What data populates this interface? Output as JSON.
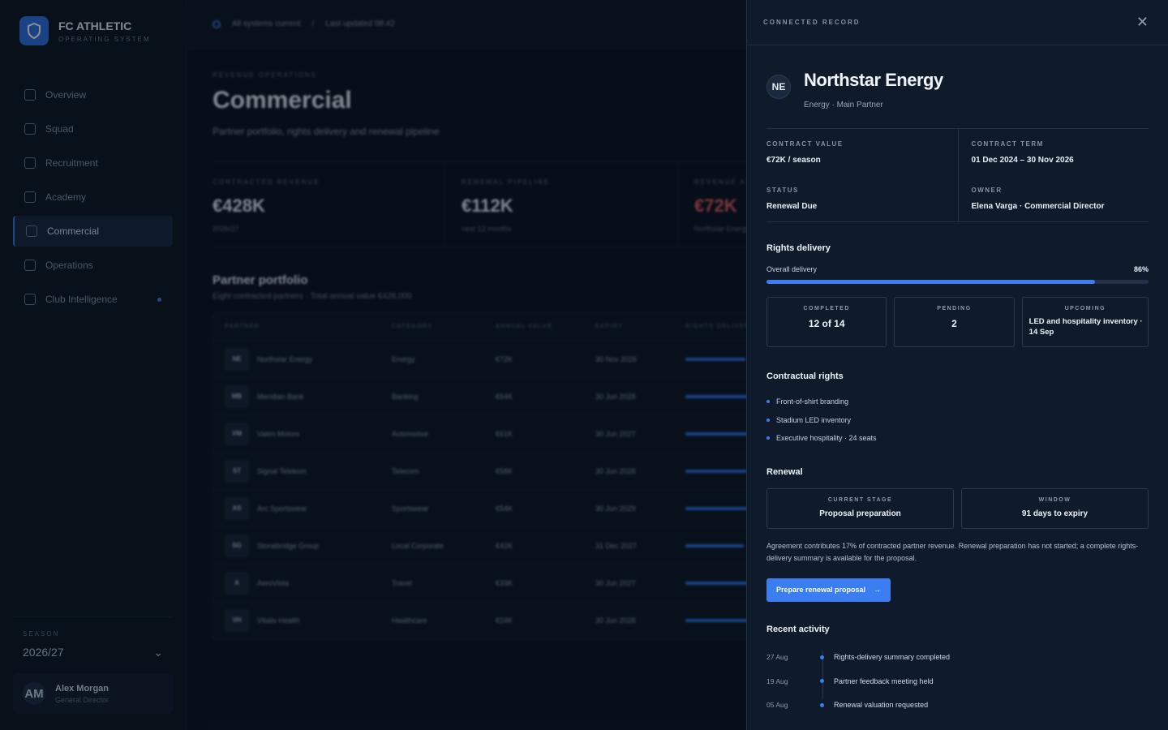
{
  "brand": {
    "name": "FC ATHLETIC",
    "sub": "OPERATING SYSTEM"
  },
  "nav": [
    {
      "label": "Overview",
      "icon": "grid-icon"
    },
    {
      "label": "Squad",
      "icon": "users-icon"
    },
    {
      "label": "Recruitment",
      "icon": "target-icon"
    },
    {
      "label": "Academy",
      "icon": "graduation-icon"
    },
    {
      "label": "Commercial",
      "icon": "briefcase-icon",
      "active": true
    },
    {
      "label": "Operations",
      "icon": "building-icon"
    },
    {
      "label": "Club Intelligence",
      "icon": "lab-icon",
      "dot": true
    }
  ],
  "season": {
    "label": "SEASON",
    "value": "2026/27"
  },
  "user": {
    "initials": "AM",
    "name": "Alex Morgan",
    "role": "General Director"
  },
  "topbar": {
    "status": "All systems current",
    "separator": "/",
    "updated": "Last updated 08:42"
  },
  "page": {
    "eyebrow": "REVENUE OPERATIONS",
    "title": "Commercial",
    "subtitle": "Partner portfolio, rights delivery and renewal pipeline"
  },
  "kpis": [
    {
      "label": "CONTRACTED REVENUE",
      "value": "€428K",
      "sub": "2026/27"
    },
    {
      "label": "RENEWAL PIPELINE",
      "value": "€112K",
      "sub": "next 12 months"
    },
    {
      "label": "REVENUE AT RISK",
      "value": "€72K",
      "sub": "Northstar Energy"
    }
  ],
  "portfolio": {
    "title": "Partner portfolio",
    "subtitle": "Eight contracted partners · Total annual value €428,000",
    "columns": [
      "PARTNER",
      "CATEGORY",
      "ANNUAL VALUE",
      "EXPIRY",
      "RIGHTS DELIVERY"
    ],
    "rows": [
      {
        "ini": "NE",
        "name": "Northstar Energy",
        "category": "Energy",
        "value": "€72K",
        "expiry": "30 Nov 2026",
        "delivery": 0.86
      },
      {
        "ini": "MB",
        "name": "Meridian Bank",
        "category": "Banking",
        "value": "€64K",
        "expiry": "30 Jun 2028",
        "delivery": 0.92
      },
      {
        "ini": "VM",
        "name": "Valen Motors",
        "category": "Automotive",
        "value": "€61K",
        "expiry": "30 Jun 2027",
        "delivery": 0.9
      },
      {
        "ini": "ST",
        "name": "Signal Telekom",
        "category": "Telecom",
        "value": "€58K",
        "expiry": "30 Jun 2028",
        "delivery": 0.88
      },
      {
        "ini": "AS",
        "name": "Arc Sportswear",
        "category": "Sportswear",
        "value": "€54K",
        "expiry": "30 Jun 2029",
        "delivery": 0.94
      },
      {
        "ini": "SG",
        "name": "Stonebridge Group",
        "category": "Local Corporate",
        "value": "€42K",
        "expiry": "31 Dec 2027",
        "delivery": 0.84
      },
      {
        "ini": "A",
        "name": "AeroVista",
        "category": "Travel",
        "value": "€33K",
        "expiry": "30 Jun 2027",
        "delivery": 0.89
      },
      {
        "ini": "VH",
        "name": "Vitalis Health",
        "category": "Healthcare",
        "value": "€24K",
        "expiry": "30 Jun 2028",
        "delivery": 0.95
      }
    ]
  },
  "drawer": {
    "label": "CONNECTED RECORD",
    "initials": "NE",
    "name": "Northstar Energy",
    "sub": "Energy · Main Partner",
    "facts": [
      {
        "label": "CONTRACT VALUE",
        "value": "€72K / season"
      },
      {
        "label": "CONTRACT TERM",
        "value": "01 Dec 2024 – 30 Nov 2026"
      },
      {
        "label": "STATUS",
        "value": "Renewal Due"
      },
      {
        "label": "OWNER",
        "value": "Elena Varga · Commercial Director"
      }
    ],
    "rights": {
      "title": "Rights delivery",
      "overall_label": "Overall delivery",
      "overall_value": "86%",
      "overall_fraction": 0.86,
      "completed": {
        "label": "COMPLETED",
        "value": "12 of 14"
      },
      "pending": {
        "label": "PENDING",
        "value": "2"
      },
      "upcoming": {
        "label": "UPCOMING",
        "value": "LED and hospitality inventory · 14 Sep"
      }
    },
    "contract": {
      "title": "Contractual rights",
      "items": [
        "Front-of-shirt branding",
        "Stadium LED inventory",
        "Executive hospitality · 24 seats"
      ]
    },
    "renewal": {
      "title": "Renewal",
      "stage": {
        "label": "CURRENT STAGE",
        "value": "Proposal preparation"
      },
      "window": {
        "label": "WINDOW",
        "value": "91 days to expiry"
      },
      "note": "Agreement contributes 17% of contracted partner revenue. Renewal preparation has not started; a complete rights-delivery summary is available for the proposal.",
      "cta": "Prepare renewal proposal"
    },
    "activity": {
      "title": "Recent activity",
      "items": [
        {
          "date": "27 Aug",
          "text": "Rights-delivery summary completed"
        },
        {
          "date": "19 Aug",
          "text": "Partner feedback meeting held"
        },
        {
          "date": "05 Aug",
          "text": "Renewal valuation requested"
        }
      ]
    }
  },
  "colors": {
    "accent": "#3b7ef2",
    "danger": "#e05a5a",
    "bg": "#0a1220",
    "panel": "#0f1a2a"
  }
}
